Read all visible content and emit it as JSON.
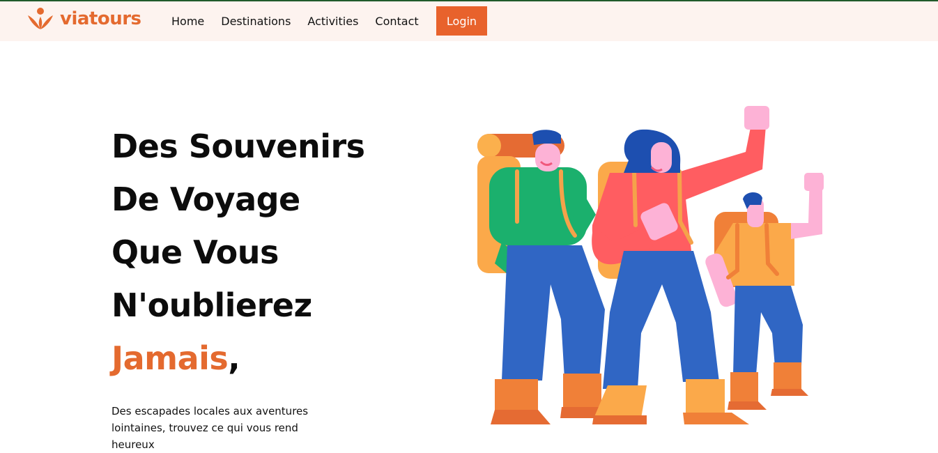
{
  "header": {
    "brand": "viatours",
    "nav": [
      "Home",
      "Destinations",
      "Activities",
      "Contact"
    ],
    "login_label": "Login"
  },
  "hero": {
    "title_lines": [
      "Des Souvenirs",
      "De Voyage",
      "Que Vous",
      "N'oublierez"
    ],
    "title_accent": "Jamais",
    "title_punct": ",",
    "description": "Des escapades locales aux aventures lointaines, trouvez ce qui vous rend heureux"
  },
  "colors": {
    "brand": "#e46a2f",
    "header_bg": "#fdf3ef",
    "button": "#e8622c"
  },
  "icons": [
    "logo-icon"
  ]
}
